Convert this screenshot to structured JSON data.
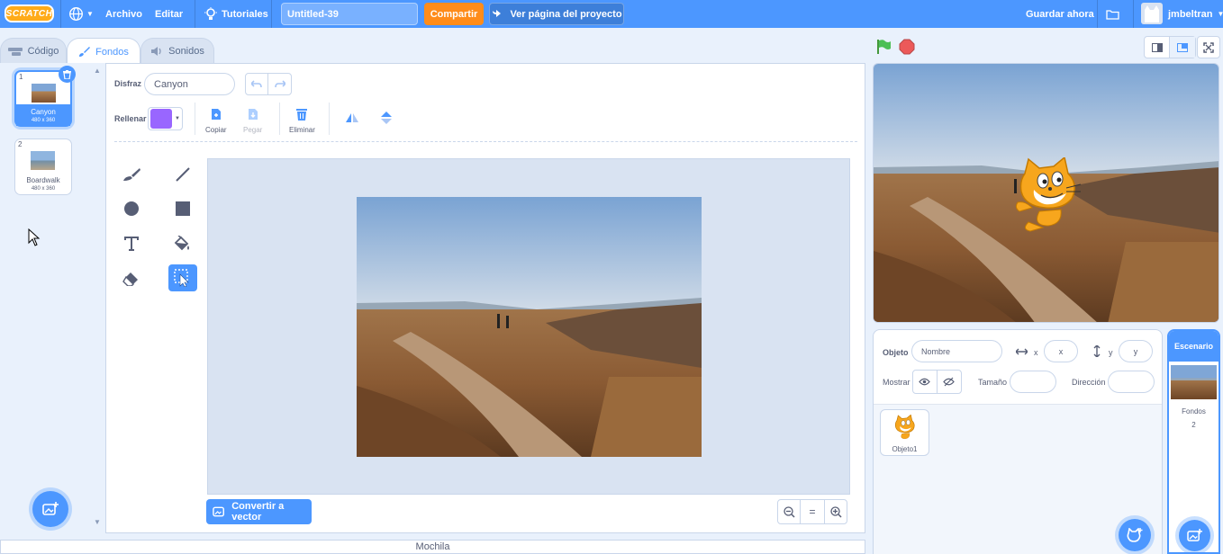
{
  "menubar": {
    "logo": "SCRATCH",
    "file": "Archivo",
    "edit": "Editar",
    "tutorials": "Tutoriales",
    "project_title": "Untitled-39",
    "share": "Compartir",
    "see_project": "Ver página del proyecto",
    "save_now": "Guardar ahora",
    "username": "jmbeltran"
  },
  "tabs": [
    {
      "label": "Código",
      "icon": "code-icon",
      "active": false
    },
    {
      "label": "Fondos",
      "icon": "brush-icon",
      "active": true
    },
    {
      "label": "Sonidos",
      "icon": "speaker-icon",
      "active": false
    }
  ],
  "costumes": [
    {
      "number": "1",
      "name": "Canyon",
      "size": "480 x 360",
      "selected": true
    },
    {
      "number": "2",
      "name": "Boardwalk",
      "size": "480 x 360",
      "selected": false
    }
  ],
  "editor": {
    "costume_label": "Disfraz",
    "costume_name": "Canyon",
    "fill_label": "Rellenar",
    "fill_color": "#9966ff",
    "copy": "Copiar",
    "paste": "Pegar",
    "delete": "Eliminar",
    "convert_vector": "Convertir a vector",
    "zoom_reset": "="
  },
  "backpack": "Mochila",
  "sprite_info": {
    "sprite_label": "Objeto",
    "name_placeholder": "Nombre",
    "x_label": "x",
    "x_placeholder": "x",
    "y_label": "y",
    "y_placeholder": "y",
    "show_label": "Mostrar",
    "size_label": "Tamaño",
    "direction_label": "Dirección"
  },
  "sprites": [
    {
      "name": "Objeto1"
    }
  ],
  "stage_panel": {
    "title": "Escenario",
    "backdrops_label": "Fondos",
    "backdrops_count": "2"
  },
  "colors": {
    "accent": "#4c97ff",
    "share": "#ff8c1a",
    "green_flag": "#4cbf56",
    "stop": "#ec5959"
  }
}
